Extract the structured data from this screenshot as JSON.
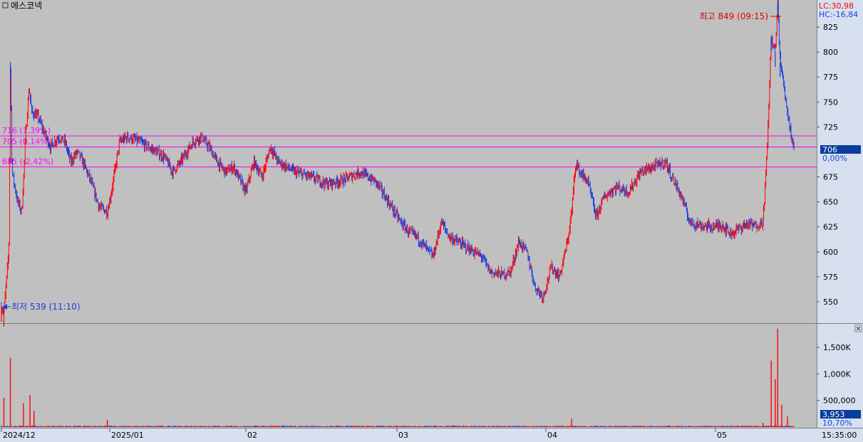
{
  "window": {
    "title": "에스코넥",
    "corner_icon": "square-icon",
    "close_icon": "close-icon"
  },
  "colors": {
    "background": "#c0c0c0",
    "axis_panel": "#d6e0ee",
    "up": "#ff0000",
    "down": "#1a3fe0",
    "guide": "#ff00ff",
    "highlight": "#0a3c9c"
  },
  "price_panel": {
    "lc_label": "LC:30,98",
    "hc_label": "HC:-16,84",
    "y_ticks": [
      "825",
      "800",
      "775",
      "750",
      "725",
      "675",
      "650",
      "625",
      "600",
      "575",
      "550"
    ],
    "current_price": "706",
    "current_change": "0,00%",
    "high_annotation": "최고 849 (09:15)",
    "low_annotation": "최저 539 (11:10)",
    "guides": [
      {
        "price": 716,
        "label": "716 (1,39%)"
      },
      {
        "price": 705,
        "label": "705 (0,14%)"
      },
      {
        "price": 685,
        "label": "685 (-2,42%)"
      }
    ]
  },
  "volume_panel": {
    "y_ticks": [
      "1,500K",
      "1,000K",
      "500,000"
    ],
    "current_volume": "3,953",
    "current_pct": "10,70%"
  },
  "x_axis": {
    "labels": [
      "2024/12",
      "2025/01",
      "02",
      "03",
      "04",
      "05"
    ],
    "time_label": "15:35:00"
  },
  "chart_data": {
    "type": "line",
    "y_range": [
      530,
      850
    ],
    "volume_range": [
      0,
      1900000
    ],
    "price_path": [
      [
        0,
        545
      ],
      [
        0.003,
        540
      ],
      [
        0.009,
        600
      ],
      [
        0.011,
        790
      ],
      [
        0.013,
        680
      ],
      [
        0.02,
        650
      ],
      [
        0.025,
        640
      ],
      [
        0.03,
        720
      ],
      [
        0.034,
        765
      ],
      [
        0.037,
        740
      ],
      [
        0.045,
        735
      ],
      [
        0.052,
        720
      ],
      [
        0.06,
        705
      ],
      [
        0.07,
        715
      ],
      [
        0.078,
        710
      ],
      [
        0.085,
        690
      ],
      [
        0.093,
        700
      ],
      [
        0.1,
        690
      ],
      [
        0.11,
        670
      ],
      [
        0.12,
        645
      ],
      [
        0.13,
        640
      ],
      [
        0.135,
        660
      ],
      [
        0.145,
        710
      ],
      [
        0.155,
        715
      ],
      [
        0.17,
        710
      ],
      [
        0.18,
        705
      ],
      [
        0.2,
        695
      ],
      [
        0.21,
        680
      ],
      [
        0.22,
        690
      ],
      [
        0.235,
        710
      ],
      [
        0.245,
        715
      ],
      [
        0.255,
        705
      ],
      [
        0.265,
        690
      ],
      [
        0.275,
        680
      ],
      [
        0.285,
        685
      ],
      [
        0.3,
        660
      ],
      [
        0.31,
        690
      ],
      [
        0.32,
        675
      ],
      [
        0.33,
        705
      ],
      [
        0.34,
        690
      ],
      [
        0.36,
        680
      ],
      [
        0.38,
        675
      ],
      [
        0.4,
        668
      ],
      [
        0.42,
        672
      ],
      [
        0.44,
        680
      ],
      [
        0.46,
        670
      ],
      [
        0.475,
        650
      ],
      [
        0.49,
        630
      ],
      [
        0.5,
        620
      ],
      [
        0.51,
        615
      ],
      [
        0.52,
        605
      ],
      [
        0.53,
        595
      ],
      [
        0.54,
        630
      ],
      [
        0.55,
        615
      ],
      [
        0.57,
        605
      ],
      [
        0.59,
        595
      ],
      [
        0.6,
        580
      ],
      [
        0.615,
        577
      ],
      [
        0.625,
        580
      ],
      [
        0.635,
        610
      ],
      [
        0.645,
        600
      ],
      [
        0.655,
        565
      ],
      [
        0.665,
        555
      ],
      [
        0.675,
        585
      ],
      [
        0.685,
        575
      ],
      [
        0.695,
        610
      ],
      [
        0.7,
        640
      ],
      [
        0.705,
        690
      ],
      [
        0.71,
        680
      ],
      [
        0.72,
        670
      ],
      [
        0.73,
        635
      ],
      [
        0.74,
        655
      ],
      [
        0.755,
        665
      ],
      [
        0.77,
        660
      ],
      [
        0.785,
        680
      ],
      [
        0.8,
        685
      ],
      [
        0.815,
        690
      ],
      [
        0.825,
        672
      ],
      [
        0.835,
        655
      ],
      [
        0.845,
        630
      ],
      [
        0.86,
        626
      ],
      [
        0.875,
        625
      ],
      [
        0.885,
        627
      ],
      [
        0.895,
        618
      ],
      [
        0.905,
        623
      ],
      [
        0.915,
        628
      ],
      [
        0.925,
        626
      ],
      [
        0.935,
        630
      ],
      [
        0.94,
        700
      ],
      [
        0.945,
        815
      ],
      [
        0.95,
        800
      ],
      [
        0.953,
        849
      ],
      [
        0.956,
        790
      ],
      [
        0.96,
        770
      ],
      [
        0.965,
        740
      ],
      [
        0.97,
        715
      ],
      [
        0.973,
        706
      ]
    ],
    "volume_spikes": [
      [
        0.011,
        1300000
      ],
      [
        0.003,
        550000
      ],
      [
        0.027,
        450000
      ],
      [
        0.035,
        600000
      ],
      [
        0.04,
        300000
      ],
      [
        0.13,
        130000
      ],
      [
        0.7,
        160000
      ],
      [
        0.91,
        30000
      ],
      [
        0.935,
        80000
      ],
      [
        0.945,
        1250000
      ],
      [
        0.95,
        900000
      ],
      [
        0.953,
        1850000
      ],
      [
        0.958,
        420000
      ],
      [
        0.965,
        200000
      ]
    ]
  }
}
